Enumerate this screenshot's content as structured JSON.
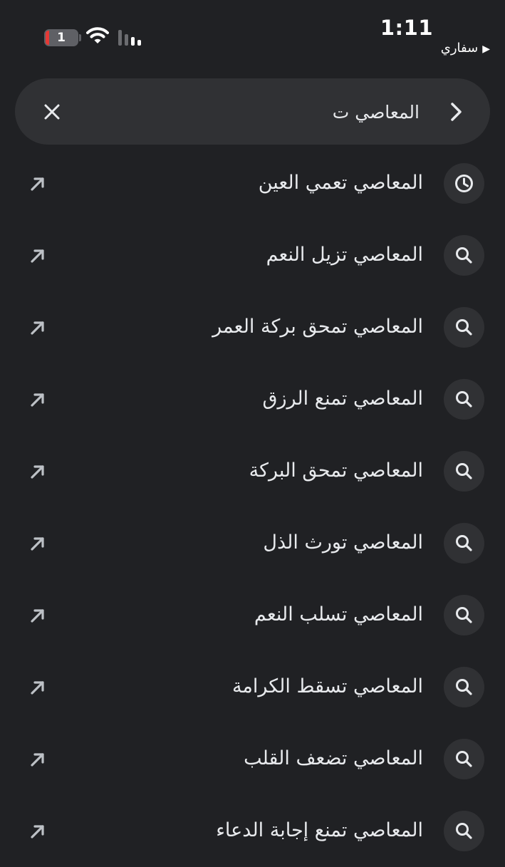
{
  "status_bar": {
    "time": "1:11",
    "battery_level": "1",
    "back_app_label": "سفاري",
    "back_arrow": "▶"
  },
  "search": {
    "query": "المعاصي ت"
  },
  "suggestions": [
    {
      "text": "المعاصي تعمي العين",
      "icon": "history-icon"
    },
    {
      "text": "المعاصي تزيل النعم",
      "icon": "search-icon"
    },
    {
      "text": "المعاصي تمحق بركة العمر",
      "icon": "search-icon"
    },
    {
      "text": "المعاصي تمنع الرزق",
      "icon": "search-icon"
    },
    {
      "text": "المعاصي تمحق البركة",
      "icon": "search-icon"
    },
    {
      "text": "المعاصي تورث الذل",
      "icon": "search-icon"
    },
    {
      "text": "المعاصي تسلب النعم",
      "icon": "search-icon"
    },
    {
      "text": "المعاصي تسقط الكرامة",
      "icon": "search-icon"
    },
    {
      "text": "المعاصي تضعف القلب",
      "icon": "search-icon"
    },
    {
      "text": "المعاصي تمنع إجابة الدعاء",
      "icon": "search-icon"
    }
  ],
  "colors": {
    "background": "#202124",
    "surface": "#303134",
    "text": "#e8eaed",
    "icon": "#bdc1c6",
    "battery_low": "#e53935"
  }
}
